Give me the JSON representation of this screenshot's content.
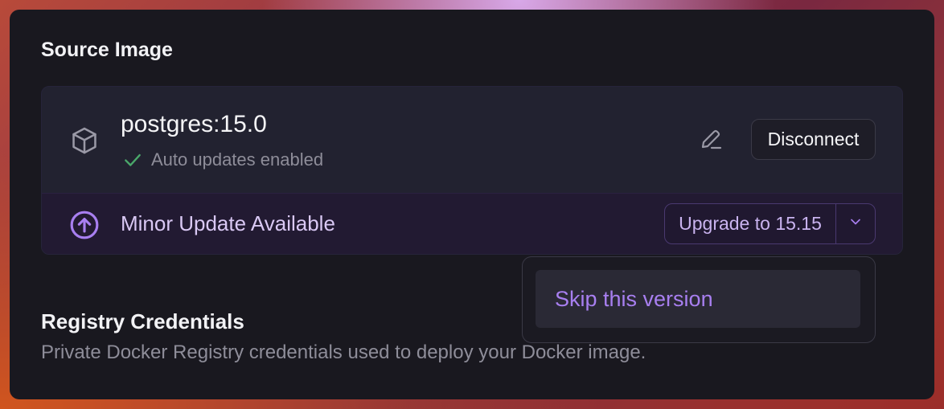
{
  "source_image": {
    "title": "Source Image",
    "image_name": "postgres:15.0",
    "auto_updates": "Auto updates enabled",
    "disconnect_label": "Disconnect"
  },
  "update": {
    "message": "Minor Update Available",
    "upgrade_label": "Upgrade to 15.15"
  },
  "dropdown": {
    "items": [
      {
        "label": "Skip this version"
      }
    ]
  },
  "registry": {
    "title": "Registry Credentials",
    "description": "Private Docker Registry credentials used to deploy your Docker image."
  },
  "icons": {
    "box": "box-icon",
    "check": "check-icon",
    "edit": "pencil-icon",
    "upgrade": "arrow-up-circle-icon",
    "chevron": "chevron-down-icon"
  },
  "colors": {
    "accent": "#a87ff0",
    "success": "#4aa86a",
    "panel": "#19181f"
  }
}
